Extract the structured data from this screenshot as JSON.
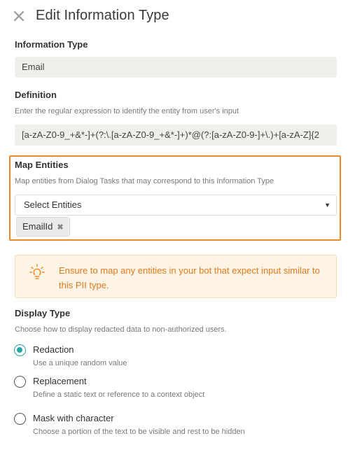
{
  "header": {
    "title": "Edit Information Type",
    "close_icon": "close-icon"
  },
  "information_type": {
    "label": "Information Type",
    "value": "Email"
  },
  "definition": {
    "label": "Definition",
    "hint": "Enter the regular expression to identify the entity from user's input",
    "value": "[a-zA-Z0-9_+&*-]+(?:\\.[a-zA-Z0-9_+&*-]+)*@(?:[a-zA-Z0-9-]+\\.)+[a-zA-Z]{2"
  },
  "map_entities": {
    "label": "Map Entities",
    "hint": "Map entities from Dialog Tasks that may correspond to this Information Type",
    "select_label": "Select Entities",
    "chips": [
      "EmailId"
    ],
    "highlight_color": "#f08a24"
  },
  "alert": {
    "icon": "lightbulb-icon",
    "text": "Ensure to map any entities in your bot that expect input similar to this PII type.",
    "color": "#e67a1e"
  },
  "display_type": {
    "label": "Display Type",
    "hint": "Choose how to display redacted data to non-authorized users.",
    "options": [
      {
        "label": "Redaction",
        "description": "Use a unique random value",
        "selected": true
      },
      {
        "label": "Replacement",
        "description": "Define a static text or reference to a context object",
        "selected": false
      },
      {
        "label": "Mask with character",
        "description": "Choose a portion of the text to be visible and rest to be hidden",
        "selected": false
      }
    ],
    "accent_color": "#29a3a8"
  }
}
